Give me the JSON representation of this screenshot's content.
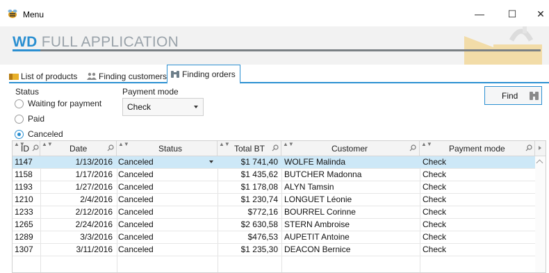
{
  "window": {
    "title": "Menu",
    "icon": "app-bee-icon",
    "controls": {
      "minimize": "—",
      "maximize": "☐",
      "close": "✕"
    }
  },
  "banner": {
    "brand_bold": "WD",
    "brand_rest": "FULL APPLICATION",
    "accent_color": "#2a8fd1"
  },
  "tabs": [
    {
      "label": "List of products",
      "icon": "products-icon"
    },
    {
      "label": "Finding customers",
      "icon": "customers-icon"
    },
    {
      "label": "Finding orders",
      "icon": "binoculars-icon",
      "active": true
    }
  ],
  "filters": {
    "status_label": "Status",
    "status_options": [
      {
        "label": "Waiting for payment",
        "selected": false
      },
      {
        "label": "Paid",
        "selected": false
      },
      {
        "label": "Canceled",
        "selected": true
      }
    ],
    "payment_label": "Payment mode",
    "payment_value": "Check",
    "find_label": "Find",
    "find_icon": "binoculars-icon"
  },
  "table": {
    "columns": [
      "ID",
      "Date",
      "Status",
      "Total BT",
      "Customer",
      "Payment mode"
    ],
    "rows": [
      {
        "id": "1147",
        "date": "1/13/2016",
        "status": "Canceled",
        "total": "$1 741,40",
        "customer": "WOLFE Malinda",
        "payment": "Check"
      },
      {
        "id": "1158",
        "date": "1/17/2016",
        "status": "Canceled",
        "total": "$1 435,62",
        "customer": "BUTCHER Madonna",
        "payment": "Check"
      },
      {
        "id": "1193",
        "date": "1/27/2016",
        "status": "Canceled",
        "total": "$1 178,08",
        "customer": "ALYN Tamsin",
        "payment": "Check"
      },
      {
        "id": "1210",
        "date": "2/4/2016",
        "status": "Canceled",
        "total": "$1 230,74",
        "customer": "LONGUET Léonie",
        "payment": "Check"
      },
      {
        "id": "1233",
        "date": "2/12/2016",
        "status": "Canceled",
        "total": "$772,16",
        "customer": "BOURREL Corinne",
        "payment": "Check"
      },
      {
        "id": "1265",
        "date": "2/24/2016",
        "status": "Canceled",
        "total": "$2 630,58",
        "customer": "STERN Ambroise",
        "payment": "Check"
      },
      {
        "id": "1289",
        "date": "3/3/2016",
        "status": "Canceled",
        "total": "$476,53",
        "customer": "AUPETIT Antoine",
        "payment": "Check"
      },
      {
        "id": "1307",
        "date": "3/11/2016",
        "status": "Canceled",
        "total": "$1 235,30",
        "customer": "DEACON Bernice",
        "payment": "Check"
      }
    ],
    "selected_row": 0
  }
}
